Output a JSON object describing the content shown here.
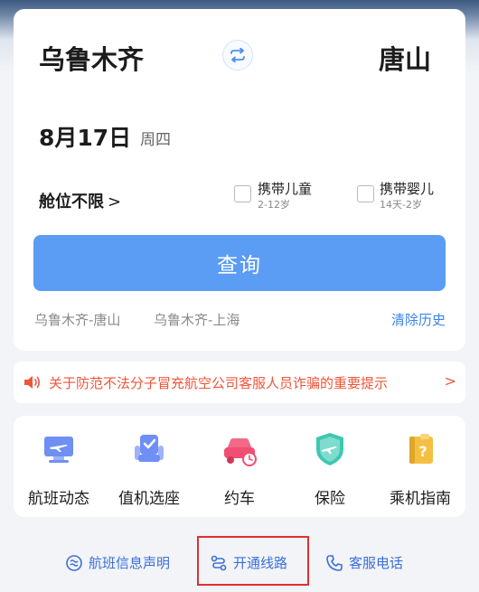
{
  "search": {
    "from_city": "乌鲁木齐",
    "to_city": "唐山",
    "date": "8月17日",
    "weekday": "周四",
    "cabin": "舱位不限",
    "child": {
      "label": "携带儿童",
      "sub": "2-12岁"
    },
    "infant": {
      "label": "携带婴儿",
      "sub": "14天-2岁"
    },
    "search_button": "查询",
    "history": [
      "乌鲁木齐-唐山",
      "乌鲁木齐-上海"
    ],
    "clear_history": "清除历史"
  },
  "notice": {
    "text": "关于防范不法分子冒充航空公司客服人员诈骗的重要提示"
  },
  "services": [
    {
      "label": "航班动态",
      "icon": "flight-status-icon"
    },
    {
      "label": "值机选座",
      "icon": "seat-selection-icon"
    },
    {
      "label": "约车",
      "icon": "car-booking-icon"
    },
    {
      "label": "保险",
      "icon": "insurance-shield-icon"
    },
    {
      "label": "乘机指南",
      "icon": "guide-icon"
    }
  ],
  "footer": {
    "flight_statement": "航班信息声明",
    "routes": "开通线路",
    "customer_service": "客服电话"
  },
  "colors": {
    "primary": "#5b9cf4",
    "link": "#3b83e8",
    "notice": "#f0553a",
    "highlight": "#e0302f"
  }
}
